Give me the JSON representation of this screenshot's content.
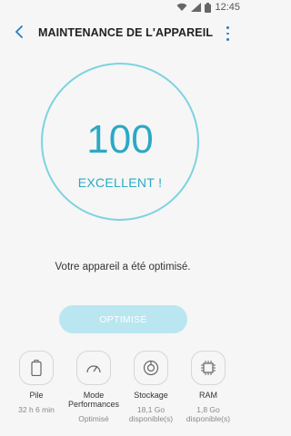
{
  "status_bar": {
    "time": "12:45",
    "icons": [
      "wifi-icon",
      "signal-icon",
      "battery-icon"
    ]
  },
  "header": {
    "title": "MAINTENANCE DE L'APPAREIL",
    "back_icon": "back-arrow-icon",
    "menu_icon": "more-vert-icon"
  },
  "score": {
    "value": "100",
    "label": "EXCELLENT !"
  },
  "status_message": "Votre appareil a été optimisé.",
  "optimize_button": {
    "label": "OPTIMISÉ"
  },
  "tools": [
    {
      "label": "Pile",
      "value": "32 h 6 min",
      "icon": "battery-icon"
    },
    {
      "label": "Mode Performances",
      "value": "Optimisé",
      "icon": "speedometer-icon"
    },
    {
      "label": "Stockage",
      "value": "18,1 Go disponible(s)",
      "icon": "storage-icon"
    },
    {
      "label": "RAM",
      "value": "1,8 Go disponible(s)",
      "icon": "memory-chip-icon"
    }
  ],
  "colors": {
    "accent": "#2ba9c5",
    "ring": "#7dd3e0",
    "button_disabled": "#b9e6f0",
    "back_arrow": "#2a7fbf",
    "background": "#f6f6f6"
  }
}
